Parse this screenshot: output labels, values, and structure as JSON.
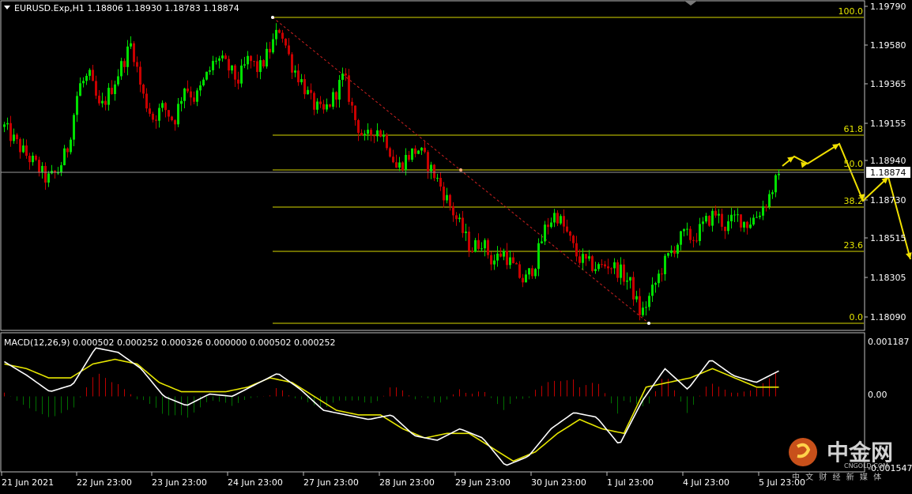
{
  "header": {
    "symbol_info": "EURUSD.Exp,H1  1.18806 1.18930 1.18783 1.18874",
    "macd_info": "MACD(12,26,9) 0.000502 0.000252 0.000326 0.000000 0.000502 0.000252"
  },
  "colors": {
    "background": "#000000",
    "bull_candle": "#00e000",
    "bear_candle": "#c80000",
    "fib_line": "#d8d800",
    "macd_line": "#ffffff",
    "signal_line": "#e6e600",
    "hist_positive": "#c00000",
    "hist_negative": "#007000",
    "forecast_arrow": "#f0e000",
    "grid_border": "#c0c0c0"
  },
  "price_axis": {
    "ticks": [
      "1.19790",
      "1.19580",
      "1.19365",
      "1.19155",
      "1.18940",
      "1.18730",
      "1.18515",
      "1.18305",
      "1.18090"
    ],
    "current_price": "1.18874"
  },
  "macd_axis": {
    "ticks": [
      "0.001187",
      "0.00",
      "-0.001547"
    ]
  },
  "time_axis": {
    "labels": [
      "21 Jun 2021",
      "22 Jun 23:00",
      "23 Jun 23:00",
      "24 Jun 23:00",
      "27 Jun 23:00",
      "28 Jun 23:00",
      "29 Jun 23:00",
      "30 Jun 23:00",
      "1 Jul 23:00",
      "4 Jul 23:00",
      "5 Jul 23:00"
    ]
  },
  "fib_levels": [
    {
      "label": "100.0",
      "price": 1.1976
    },
    {
      "label": "61.8",
      "price": 1.1907
    },
    {
      "label": "50.0",
      "price": 1.1885
    },
    {
      "label": "38.2",
      "price": 1.1864
    },
    {
      "label": "23.6",
      "price": 1.1837
    },
    {
      "label": "0.0",
      "price": 1.1794
    }
  ],
  "watermark": {
    "name": "中金网",
    "sub_en": "CNGOLD.COM",
    "sub_cn": "中 文 财 经 新 媒 体"
  },
  "chart_data": {
    "type": "candlestick",
    "symbol": "EURUSD.Exp",
    "timeframe": "H1",
    "last_bar": {
      "open": 1.18806,
      "high": 1.1893,
      "low": 1.18783,
      "close": 1.18874
    },
    "ylim": [
      1.1794,
      1.1979
    ],
    "close_path": [
      1.1913,
      1.1905,
      1.1898,
      1.1892,
      1.1884,
      1.1888,
      1.1902,
      1.1935,
      1.1941,
      1.1922,
      1.1933,
      1.1946,
      1.1959,
      1.1931,
      1.1918,
      1.1924,
      1.1916,
      1.1936,
      1.1928,
      1.194,
      1.1951,
      1.1946,
      1.1938,
      1.195,
      1.1944,
      1.1955,
      1.1968,
      1.1948,
      1.1938,
      1.1926,
      1.192,
      1.1929,
      1.1941,
      1.1918,
      1.1905,
      1.1913,
      1.1906,
      1.189,
      1.1897,
      1.1901,
      1.1892,
      1.1882,
      1.187,
      1.1858,
      1.1846,
      1.1851,
      1.1839,
      1.1845,
      1.1836,
      1.1828,
      1.1838,
      1.1858,
      1.1866,
      1.1855,
      1.1842,
      1.1838,
      1.1836,
      1.1838,
      1.1834,
      1.1827,
      1.181,
      1.1822,
      1.1836,
      1.1846,
      1.1854,
      1.1852,
      1.186,
      1.1866,
      1.1858,
      1.1864,
      1.186,
      1.1865,
      1.1874,
      1.1887
    ],
    "macd_ylim": [
      -0.001547,
      0.001187
    ],
    "macd_path": [
      0.00075,
      0.00045,
      0.0001,
      0.00025,
      0.00105,
      0.00095,
      0.0006,
      0.0,
      -0.0002,
      5e-05,
      0.0,
      0.00025,
      0.0005,
      0.00015,
      -0.0003,
      -0.0004,
      -0.0005,
      -0.0004,
      -0.00085,
      -0.00095,
      -0.0007,
      -0.0009,
      -0.0015,
      -0.0013,
      -0.0007,
      -0.00035,
      -0.00045,
      -0.00105,
      -0.0001,
      0.0006,
      0.00015,
      0.0008,
      0.00045,
      0.0003,
      0.00055
    ],
    "signal_path": [
      0.0007,
      0.0006,
      0.0004,
      0.0004,
      0.0007,
      0.0008,
      0.0007,
      0.0003,
      0.0001,
      0.0001,
      0.0001,
      0.0002,
      0.0004,
      0.0003,
      0.0,
      -0.0003,
      -0.0004,
      -0.0004,
      -0.0007,
      -0.0009,
      -0.0008,
      -0.0008,
      -0.0011,
      -0.0014,
      -0.0012,
      -0.0008,
      -0.0005,
      -0.0007,
      -0.0008,
      0.0002,
      0.0003,
      0.0004,
      0.0006,
      0.0004,
      0.0002,
      0.0002
    ]
  }
}
